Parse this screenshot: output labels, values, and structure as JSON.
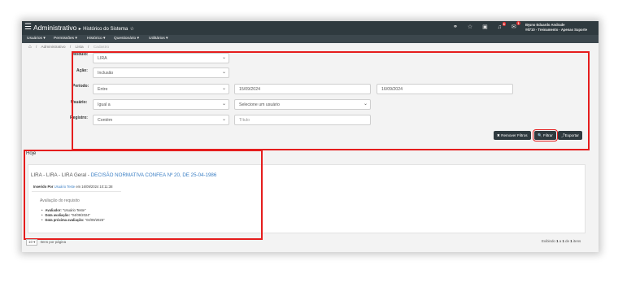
{
  "header": {
    "title": "Administrativo",
    "arrow": "▸",
    "subtitle": "Histórico do Sistema",
    "star": "☆",
    "user_name": "Bruno Eduardo Andrade",
    "user_role": "#6710 - Treinamento - Apenas Suporte",
    "icons": [
      "network-icon",
      "star-icon",
      "calendar-icon",
      "bell-icon",
      "mail-icon",
      "more-icon"
    ],
    "badges": {
      "bell": "6",
      "mail": "1"
    }
  },
  "nav": {
    "items": [
      "Usuários ▾",
      "Permissões ▾",
      "Histórico ▾",
      "Questionário ▾",
      "Utilitários ▾"
    ]
  },
  "breadcrumb": {
    "home": "⌂",
    "items": [
      "Administrativo",
      "Lista",
      "Cadastro"
    ]
  },
  "filters": {
    "modulo_label": "Módulo:",
    "modulo_value": "LIRA",
    "acao_label": "Ação:",
    "acao_value": "Inclusão",
    "periodo_label": "Período:",
    "periodo_op": "Entre",
    "periodo_from": "15/09/2024",
    "periodo_to": "16/09/2024",
    "usuario_label": "Usuário:",
    "usuario_op": "Igual a",
    "usuario_value": "Selecione um usuário",
    "registro_label": "Registro:",
    "registro_op": "Contém",
    "registro_placeholder": "Título",
    "caret": "⌄"
  },
  "buttons": {
    "remove": "✖ Remover Filtros",
    "filter": "🔍 Filtrar",
    "export": "⤴Exportar"
  },
  "results": {
    "day": "Hoje",
    "title_prefix": "LIRA - LIRA - LIRA Geral - ",
    "title_link": "DECISÃO NORMATIVA CONFEA Nº 20, DE 25-04-1986",
    "inserted_label": "Inserido Por",
    "inserted_user": "Usuário Teste",
    "inserted_when": "em 16/09/2024 10:11:38",
    "eval_heading": "Avaliação do requisito",
    "eval_items": [
      {
        "label": "Avaliador:",
        "value": "\"Usuário Teste\""
      },
      {
        "label": "Data avaliação:",
        "value": "\"04/09/2024\""
      },
      {
        "label": "Data próxima avaliação:",
        "value": "\"04/09/2025\""
      }
    ]
  },
  "pagination": {
    "per_page": "10 ▾",
    "per_page_label": "Itens por página",
    "showing": "Exibindo",
    "from": "1",
    "to_word": "a",
    "to": "1",
    "of_word": "de",
    "total": "1",
    "items_word": "itens"
  },
  "colors": {
    "topbar": "#2f3a3f",
    "highlight": "#e51d1d",
    "link": "#3b7fc4"
  }
}
